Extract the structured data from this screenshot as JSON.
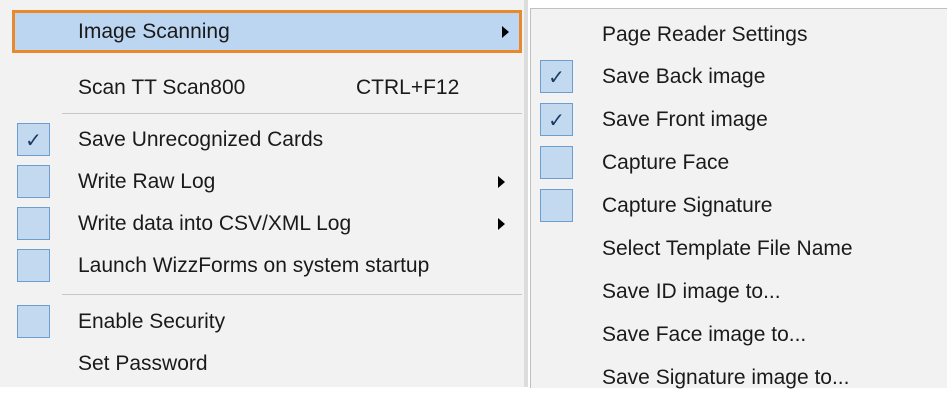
{
  "main_menu": {
    "items": [
      {
        "label": "Image Scanning",
        "submenu": true
      },
      {
        "label": "Scan TT Scan800",
        "shortcut": "CTRL+F12"
      },
      {
        "label": "Save Unrecognized Cards",
        "checked": true
      },
      {
        "label": "Write Raw Log",
        "checked": false,
        "submenu": true
      },
      {
        "label": "Write data into CSV/XML Log",
        "checked": false,
        "submenu": true
      },
      {
        "label": "Launch WizzForms on system startup",
        "checked": false
      },
      {
        "label": "Enable Security",
        "checked": false
      },
      {
        "label": "Set Password"
      }
    ]
  },
  "submenu": {
    "items": [
      {
        "label": "Page Reader Settings"
      },
      {
        "label": "Save Back image",
        "checked": true
      },
      {
        "label": "Save Front image",
        "checked": true
      },
      {
        "label": "Capture Face",
        "checked": false
      },
      {
        "label": "Capture Signature",
        "checked": false
      },
      {
        "label": "Select Template File Name"
      },
      {
        "label": "Save ID image to..."
      },
      {
        "label": "Save Face image to..."
      },
      {
        "label": "Save Signature image to..."
      }
    ]
  },
  "glyphs": {
    "check": "✓"
  },
  "colors": {
    "highlight": "#bcd6f1",
    "highlight_border": "#e8892c",
    "checkbox_fill": "#c3d9ef",
    "checkbox_border": "#6d9ed0",
    "menu_bg": "#f2f2f2"
  }
}
